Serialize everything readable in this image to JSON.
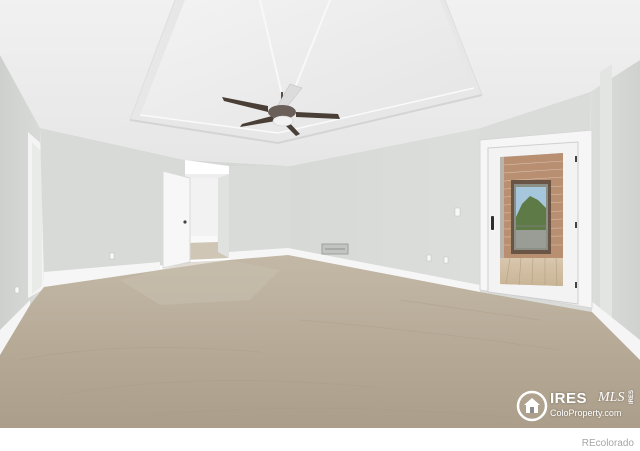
{
  "photo": {
    "description_icon": "house-icon"
  },
  "watermark": {
    "brand": "IRES",
    "mls": "MLS",
    "site": "ColoProperty.com",
    "side_text": "IRES"
  },
  "credit": "REcolorado",
  "colors": {
    "wall": "#d9dcd9",
    "ceiling": "#eeeeee",
    "carpet": "#b6a995",
    "trim": "#f4f4f4"
  }
}
